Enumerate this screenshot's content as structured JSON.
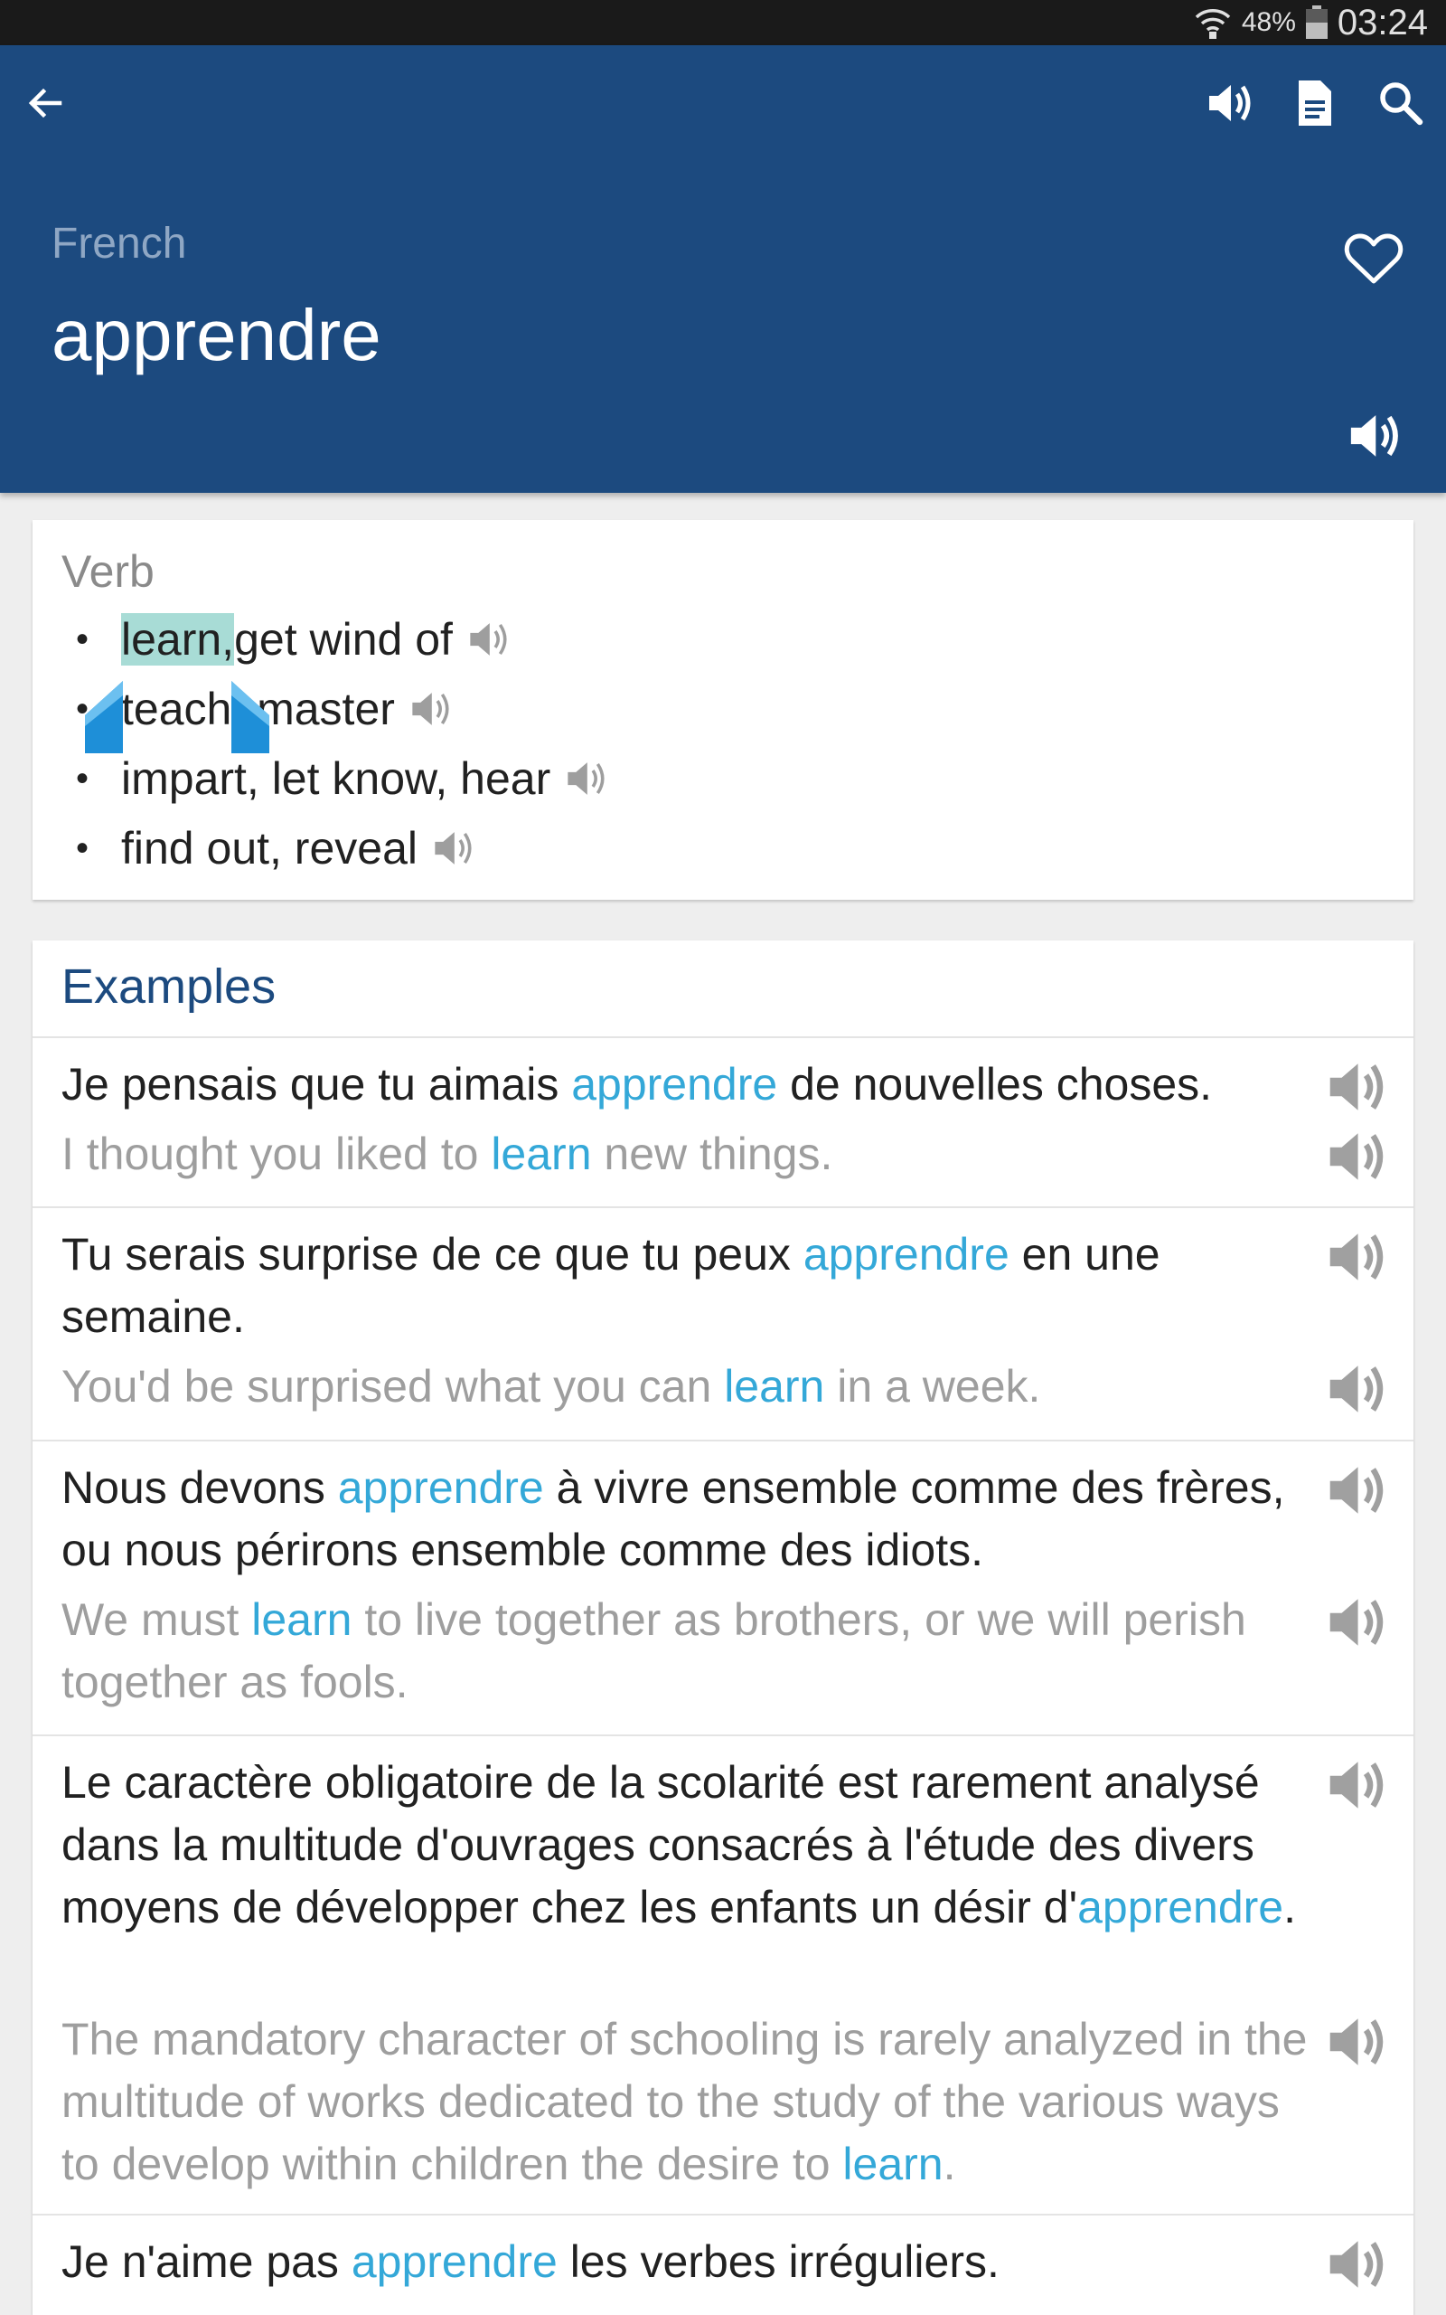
{
  "status_bar": {
    "battery": "48%",
    "time": "03:24"
  },
  "header": {
    "language": "French",
    "word": "apprendre"
  },
  "definition": {
    "part_of_speech": "Verb",
    "senses": [
      {
        "highlight": "learn,",
        "rest": " get wind of"
      },
      {
        "highlight": "",
        "rest": "teach, master"
      },
      {
        "highlight": "",
        "rest": "impart, let know, hear"
      },
      {
        "highlight": "",
        "rest": "find out, reveal"
      }
    ]
  },
  "examples": {
    "title": "Examples",
    "items": [
      {
        "fr": [
          "Je pensais que tu aimais ",
          "apprendre",
          " de nouvelles choses."
        ],
        "en": [
          "I thought you liked to ",
          "learn",
          " new things."
        ]
      },
      {
        "fr": [
          "Tu serais surprise de ce que tu peux ",
          "apprendre",
          " en une semaine."
        ],
        "en": [
          "You'd be surprised what you can ",
          "learn",
          " in a week."
        ]
      },
      {
        "fr": [
          "Nous devons ",
          "apprendre",
          " à vivre ensemble comme des frères, ou nous périrons ensemble comme des idiots."
        ],
        "en": [
          "We must ",
          "learn",
          " to live together as brothers, or we will perish together as fools."
        ]
      },
      {
        "fr": [
          "Le caractère obligatoire de la scolarité est rarement analysé dans la multitude d'ouvrages consacrés à l'étude des divers moyens de développer chez les enfants un désir d'",
          "apprendre",
          "."
        ],
        "en": [
          "The mandatory character of schooling is rarely analyzed in the multitude of works dedicated to the study of the various ways to develop within children the desire to ",
          "learn",
          "."
        ]
      },
      {
        "fr": [
          "Je n'aime pas ",
          "apprendre",
          " les verbes irréguliers."
        ],
        "en": [
          "",
          "",
          ""
        ]
      }
    ]
  },
  "colors": {
    "header_bg": "#1c4a7f",
    "keyword": "#34a8d8",
    "selection": "#a8dcd6",
    "handle": "#1e8fd8"
  },
  "icons": [
    "back-arrow-icon",
    "speaker-icon",
    "document-icon",
    "search-icon",
    "heart-icon",
    "wifi-icon",
    "battery-icon",
    "selection-handle-icon"
  ]
}
